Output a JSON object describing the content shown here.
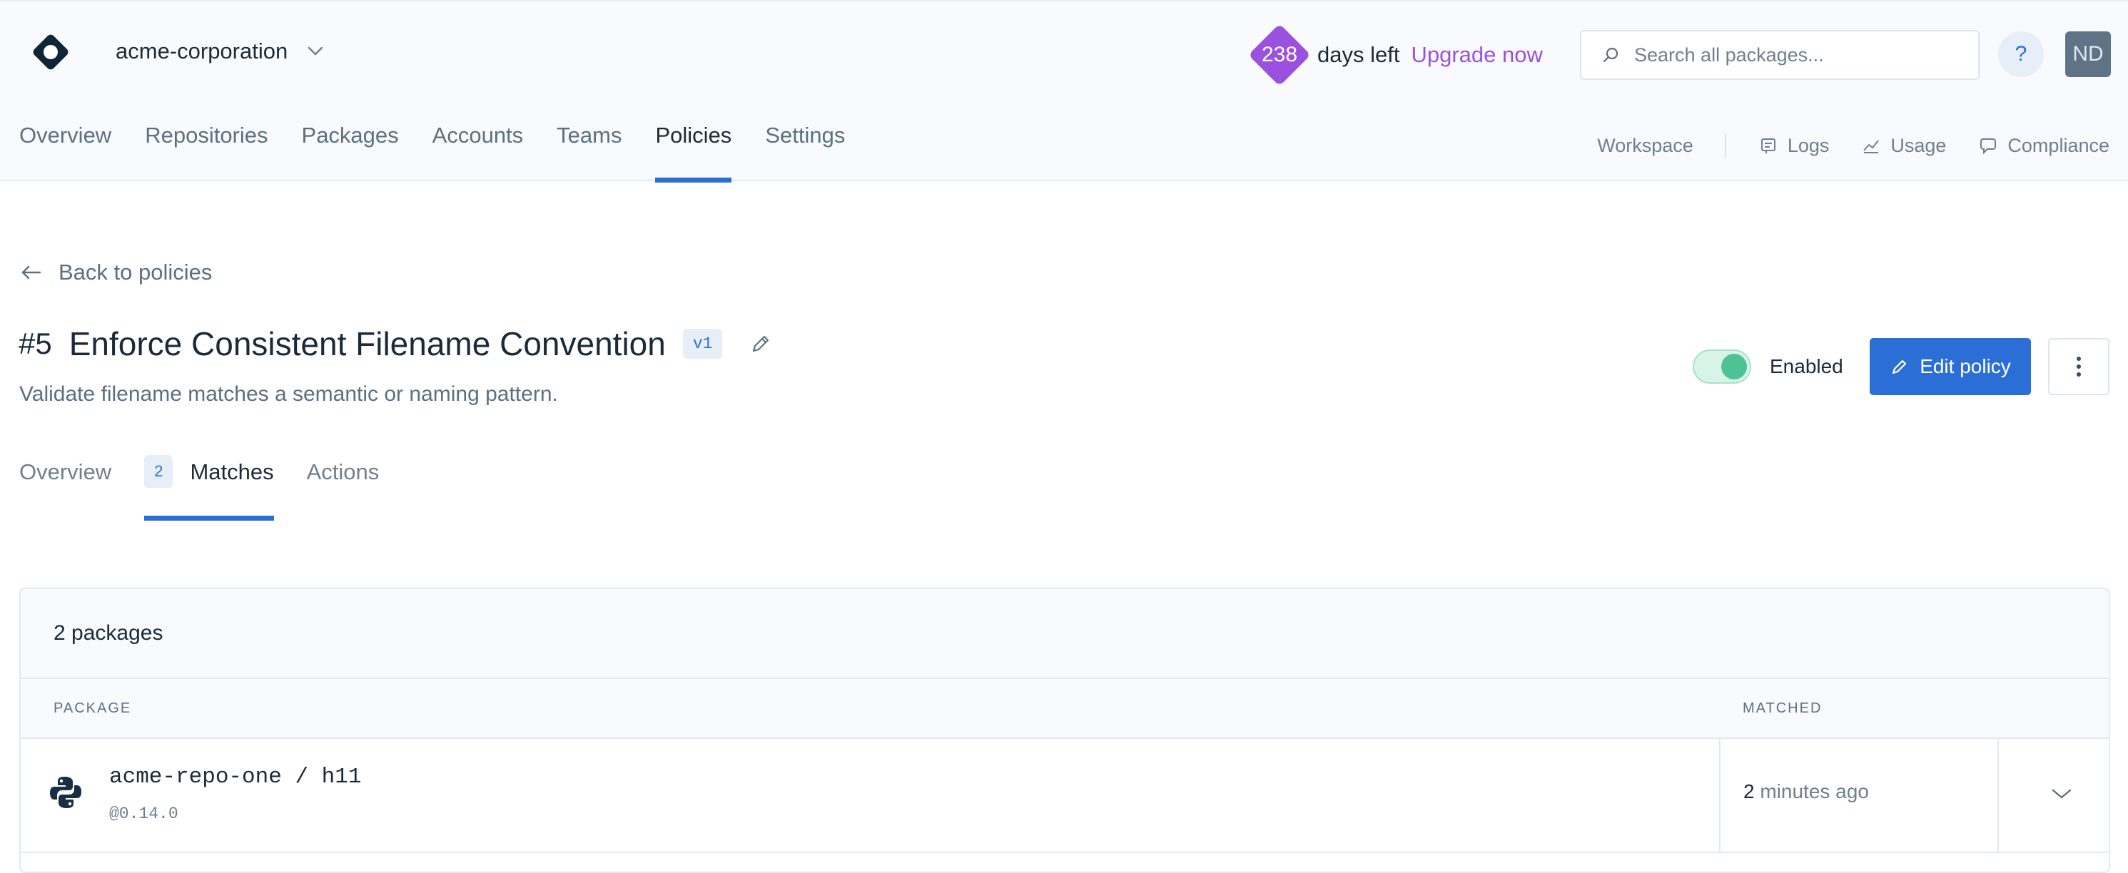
{
  "header": {
    "org_name": "acme-corporation",
    "trial_days": "238",
    "trial_suffix": "days left",
    "upgrade_label": "Upgrade now",
    "search_placeholder": "Search all packages...",
    "help_label": "?",
    "avatar_initials": "ND"
  },
  "main_nav": [
    {
      "label": "Overview"
    },
    {
      "label": "Repositories"
    },
    {
      "label": "Packages"
    },
    {
      "label": "Accounts"
    },
    {
      "label": "Teams"
    },
    {
      "label": "Policies",
      "active": true
    },
    {
      "label": "Settings"
    }
  ],
  "sub_nav": {
    "workspace": "Workspace",
    "logs": "Logs",
    "usage": "Usage",
    "compliance": "Compliance"
  },
  "page": {
    "back_label": "Back to policies",
    "policy_number": "#5",
    "policy_title": "Enforce Consistent Filename Convention",
    "version": "v1",
    "description": "Validate filename matches a semantic or naming pattern.",
    "enabled_label": "Enabled",
    "enabled": true,
    "edit_label": "Edit policy"
  },
  "tabs": {
    "overview": "Overview",
    "matches_count": "2",
    "matches": "Matches",
    "actions": "Actions"
  },
  "table": {
    "summary": "2 packages",
    "col_package": "PACKAGE",
    "col_matched": "MATCHED",
    "rows": [
      {
        "package": "acme-repo-one / h11",
        "version": "@0.14.0",
        "matched_num": "2",
        "matched_rest": "minutes ago",
        "icon": "python-icon"
      }
    ]
  },
  "colors": {
    "accent": "#2b6fd6",
    "trial": "#9b51e0",
    "toggle_on": "#4dc295"
  }
}
